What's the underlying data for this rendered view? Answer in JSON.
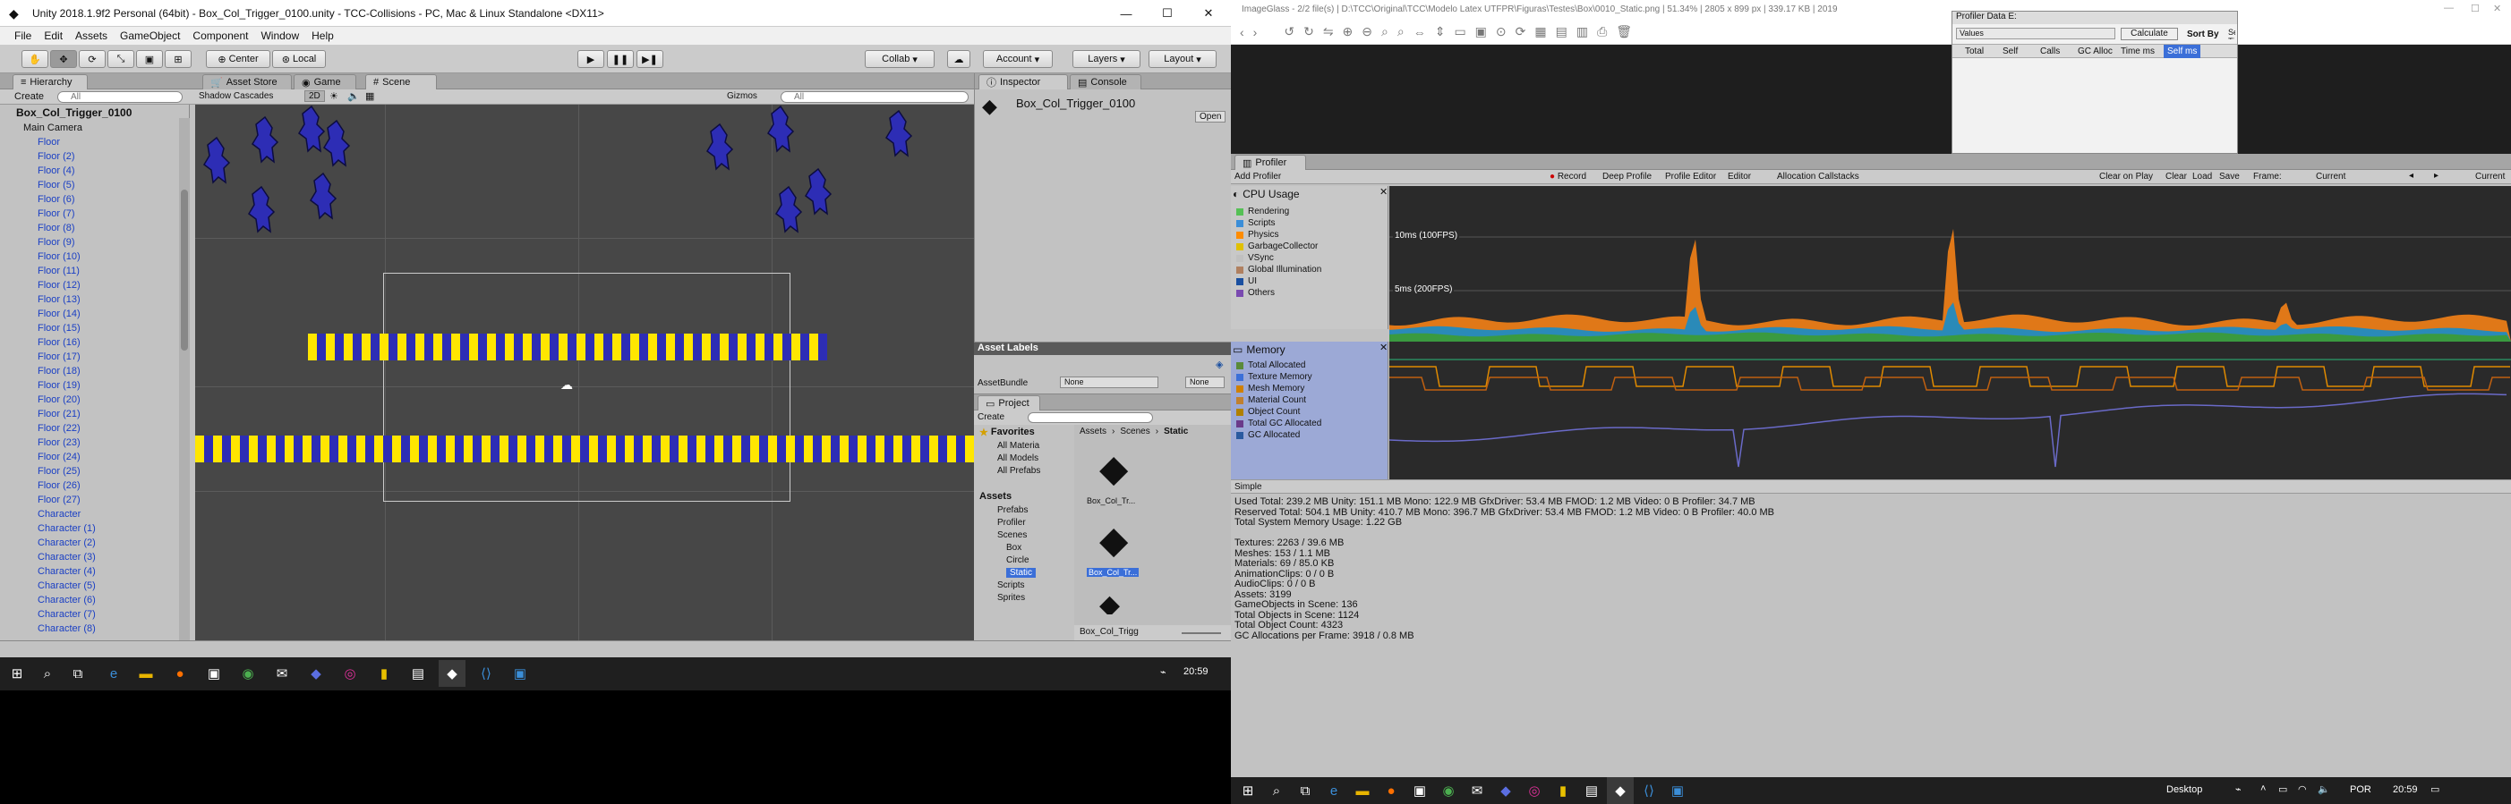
{
  "unity": {
    "title": "Unity 2018.1.9f2 Personal (64bit) - Box_Col_Trigger_0100.unity - TCC-Collisions - PC, Mac & Linux Standalone <DX11>",
    "menu": [
      "File",
      "Edit",
      "Assets",
      "GameObject",
      "Component",
      "Window",
      "Help"
    ],
    "toolbar": {
      "center": "Center",
      "local": "Local",
      "collab": "Collab",
      "account": "Account",
      "layers": "Layers",
      "layout": "Layout"
    },
    "hierarchy": {
      "tab": "Hierarchy",
      "create": "Create",
      "search_placeholder": "All",
      "root": "Box_Col_Trigger_0100",
      "items": [
        "Main Camera",
        "Floor",
        "Floor (2)",
        "Floor (4)",
        "Floor (5)",
        "Floor (6)",
        "Floor (7)",
        "Floor (8)",
        "Floor (9)",
        "Floor (10)",
        "Floor (11)",
        "Floor (12)",
        "Floor (13)",
        "Floor (14)",
        "Floor (15)",
        "Floor (16)",
        "Floor (17)",
        "Floor (18)",
        "Floor (19)",
        "Floor (20)",
        "Floor (21)",
        "Floor (22)",
        "Floor (23)",
        "Floor (24)",
        "Floor (25)",
        "Floor (26)",
        "Floor (27)",
        "Character",
        "Character (1)",
        "Character (2)",
        "Character (3)",
        "Character (4)",
        "Character (5)",
        "Character (6)",
        "Character (7)",
        "Character (8)"
      ]
    },
    "scene": {
      "tab_asset_store": "Asset Store",
      "tab_game": "Game",
      "tab_scene": "Scene",
      "shading": "Shadow Cascades",
      "mode_2d": "2D",
      "gizmos": "Gizmos",
      "search_placeholder": "All"
    },
    "inspector": {
      "tab": "Inspector",
      "console_tab": "Console",
      "object_name": "Box_Col_Trigger_0100",
      "open": "Open"
    },
    "asset_labels": {
      "title": "Asset Labels",
      "bundle_label": "AssetBundle",
      "bundle_value": "None",
      "variant_value": "None"
    },
    "project": {
      "tab": "Project",
      "create": "Create",
      "favorites": "Favorites",
      "fav_items": [
        "All Materia",
        "All Models",
        "All Prefabs"
      ],
      "assets": "Assets",
      "folders": [
        "Prefabs",
        "Profiler",
        "Scenes",
        "Box",
        "Circle",
        "Static",
        "Scripts",
        "Sprites"
      ],
      "breadcrumb": [
        "Assets",
        "Scenes",
        "Static"
      ],
      "files": [
        "Box_Col_Tr...",
        "Box_Col_Tr..."
      ],
      "footer": "Box_Col_Trigg"
    }
  },
  "taskbar_left": {
    "clock": "20:59"
  },
  "imageglass": {
    "title": "ImageGlass - 2/2 file(s) | D:\\TCC\\Original\\TCC\\Modelo Latex UTFPR\\Figuras\\Testes\\Box\\0010_Static.png | 51.34% | 2805 x 899 px | 339.17 KB | 2019"
  },
  "profiler_data": {
    "title": "Profiler Data E:",
    "values": "Values",
    "calculate": "Calculate",
    "sort_by": "Sort By",
    "self_time": "Self Time",
    "columns": [
      "Total",
      "Self",
      "Calls",
      "GC Alloc",
      "Time ms",
      "Self ms"
    ]
  },
  "profiler": {
    "tab": "Profiler",
    "add_profiler": "Add Profiler",
    "toolbar": [
      "Record",
      "Deep Profile",
      "Profile Editor",
      "Editor",
      "Allocation Callstacks"
    ],
    "toolbar_right": [
      "Clear on Play",
      "Clear",
      "Load",
      "Save"
    ],
    "frame_label": "Frame:",
    "frame_value": "Current",
    "current": "Current",
    "cpu_title": "CPU Usage",
    "cpu_legend": [
      {
        "label": "Rendering",
        "color": "#55c055"
      },
      {
        "label": "Scripts",
        "color": "#3b8ed8"
      },
      {
        "label": "Physics",
        "color": "#ff8c00"
      },
      {
        "label": "GarbageCollector",
        "color": "#e0c000"
      },
      {
        "label": "VSync",
        "color": "#c0c0c0"
      },
      {
        "label": "Global Illumination",
        "color": "#b08060"
      },
      {
        "label": "UI",
        "color": "#1a4fa0"
      },
      {
        "label": "Others",
        "color": "#7a4ab0"
      }
    ],
    "cpu_marks": [
      "10ms (100FPS)",
      "5ms (200FPS)"
    ],
    "memory_title": "Memory",
    "memory_legend": [
      {
        "label": "Total Allocated",
        "color": "#5a8a3a"
      },
      {
        "label": "Texture Memory",
        "color": "#3b6fd8"
      },
      {
        "label": "Mesh Memory",
        "color": "#d08000"
      },
      {
        "label": "Material Count",
        "color": "#c08030"
      },
      {
        "label": "Object Count",
        "color": "#b08000"
      },
      {
        "label": "Total GC Allocated",
        "color": "#6a3a8a"
      },
      {
        "label": "GC Allocated",
        "color": "#2a5aa0"
      }
    ],
    "mode": "Simple",
    "stats": [
      "Used Total: 239.2 MB   Unity: 151.1 MB   Mono: 122.9 MB   GfxDriver: 53.4 MB   FMOD: 1.2 MB   Video: 0 B   Profiler: 34.7 MB",
      "Reserved Total: 504.1 MB   Unity: 410.7 MB   Mono: 396.7 MB   GfxDriver: 53.4 MB   FMOD: 1.2 MB   Video: 0 B   Profiler: 40.0 MB",
      "Total System Memory Usage: 1.22 GB",
      "",
      "Textures: 2263 / 39.6 MB",
      "Meshes: 153 / 1.1 MB",
      "Materials: 69 / 85.0 KB",
      "AnimationClips: 0 / 0 B",
      "AudioClips: 0 / 0 B",
      "Assets: 3199",
      "GameObjects in Scene: 136",
      "Total Objects in Scene: 1124",
      "Total Object Count: 4323",
      "GC Allocations per Frame: 3918 / 0.8 MB"
    ]
  },
  "taskbar_right": {
    "desktop": "Desktop",
    "lang": "POR",
    "clock": "20:59"
  }
}
